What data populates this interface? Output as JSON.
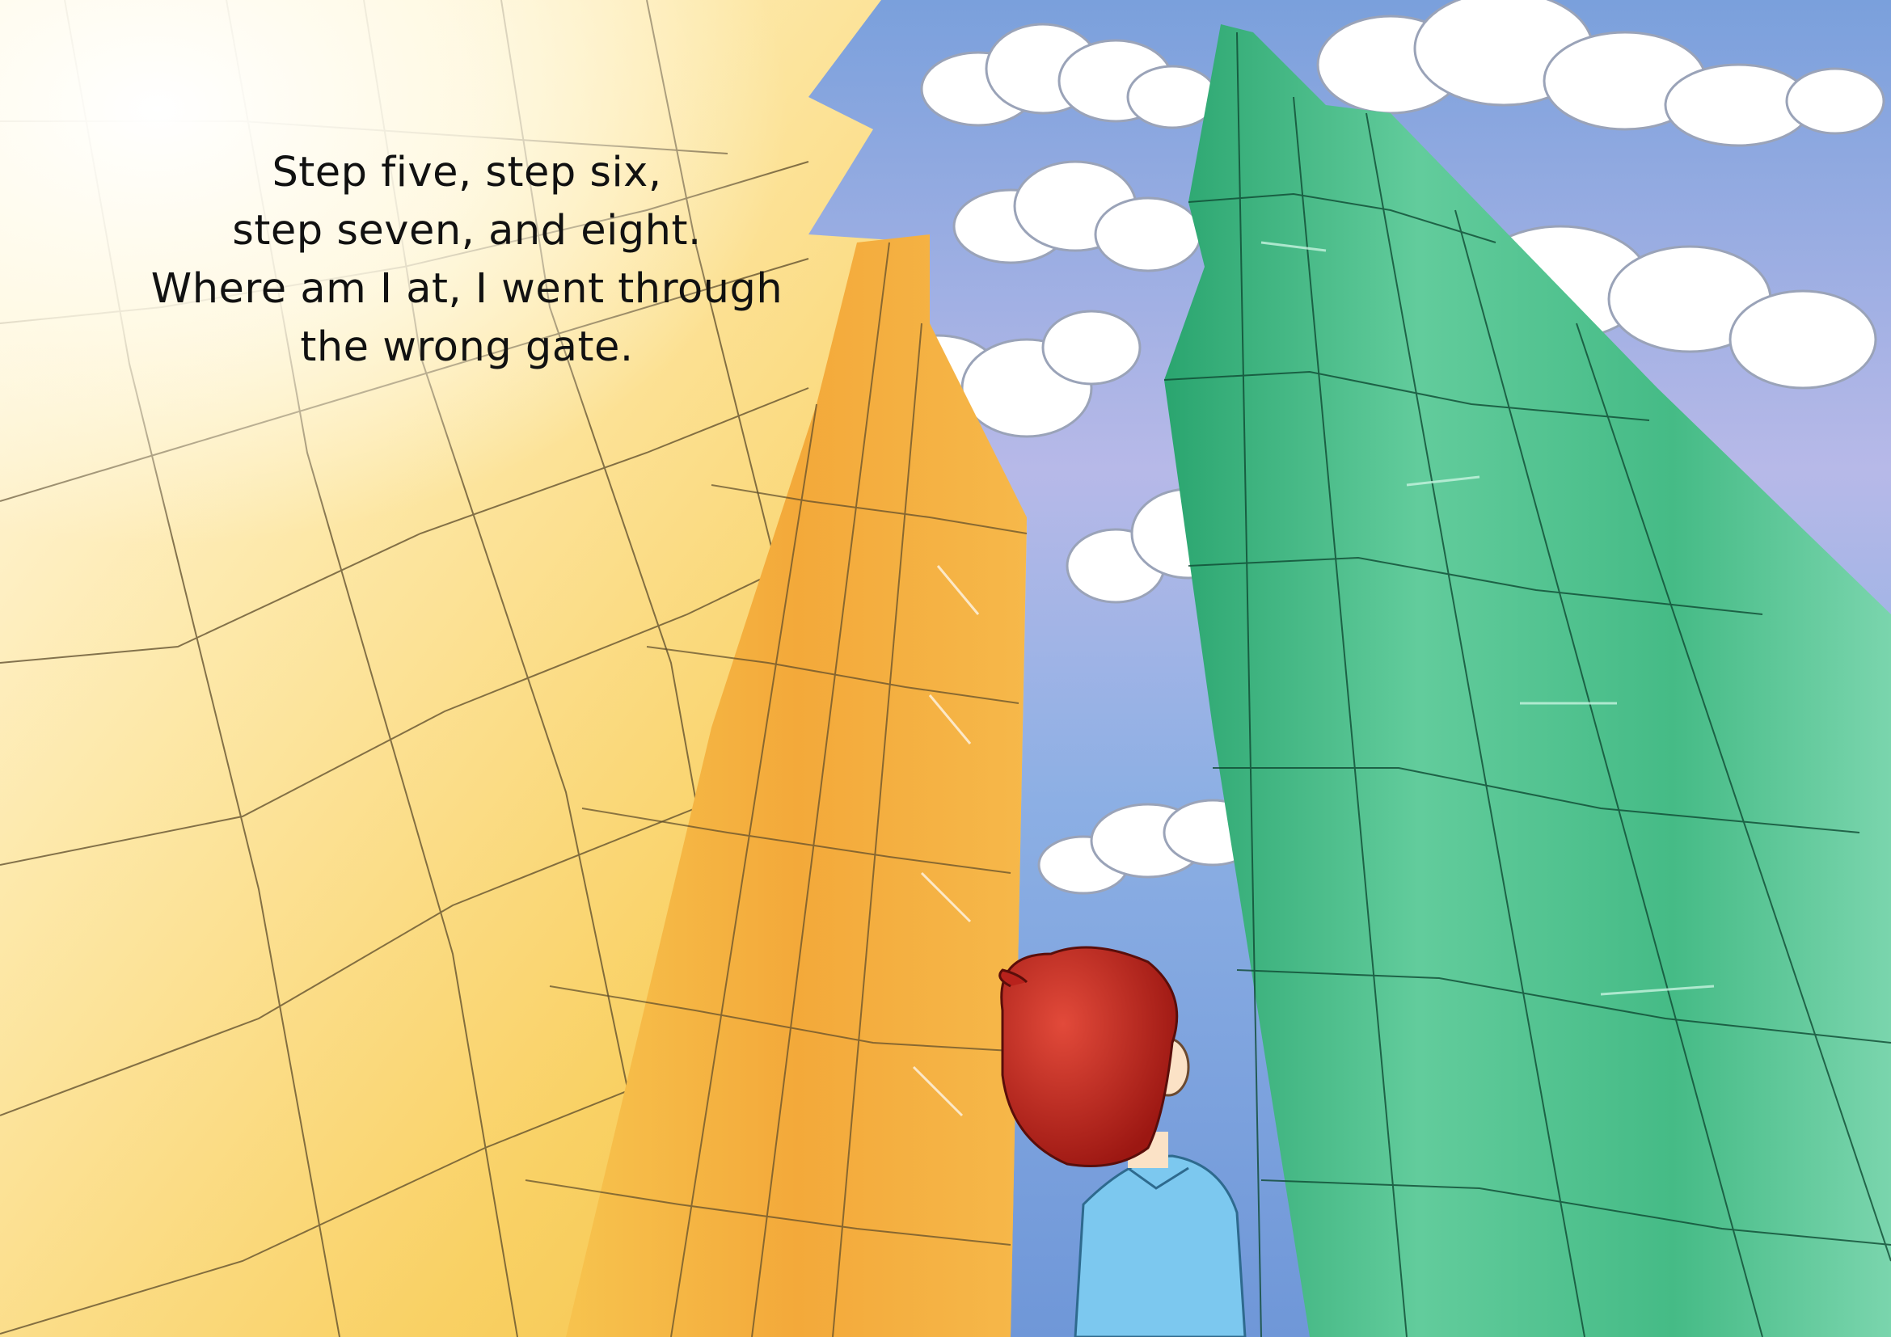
{
  "story": {
    "lines": [
      "Step five, step six,",
      "step seven, and eight.",
      "Where am I at, I went through",
      "the wrong gate."
    ]
  },
  "colors": {
    "sky_top": "#7aa0dc",
    "sky_mid": "#a9b8e6",
    "sky_bottom": "#6f97d8",
    "gold_building_light": "#fff3cf",
    "gold_building_mid": "#f8cd57",
    "gold_building_dark": "#f0a93a",
    "green_building_light": "#7fd8b2",
    "green_building_mid": "#37b47e",
    "green_building_dark": "#1f8a5b",
    "cloud_fill": "#ffffff",
    "boy_hair": "#b8221c",
    "boy_shirt": "#7cc8ef",
    "boy_skin": "#fbe2c6"
  },
  "illustration": {
    "elements": [
      "sky",
      "clouds",
      "golden-skyscraper",
      "orange-tower",
      "green-skyscraper",
      "boy-red-hair-blue-shirt"
    ]
  }
}
